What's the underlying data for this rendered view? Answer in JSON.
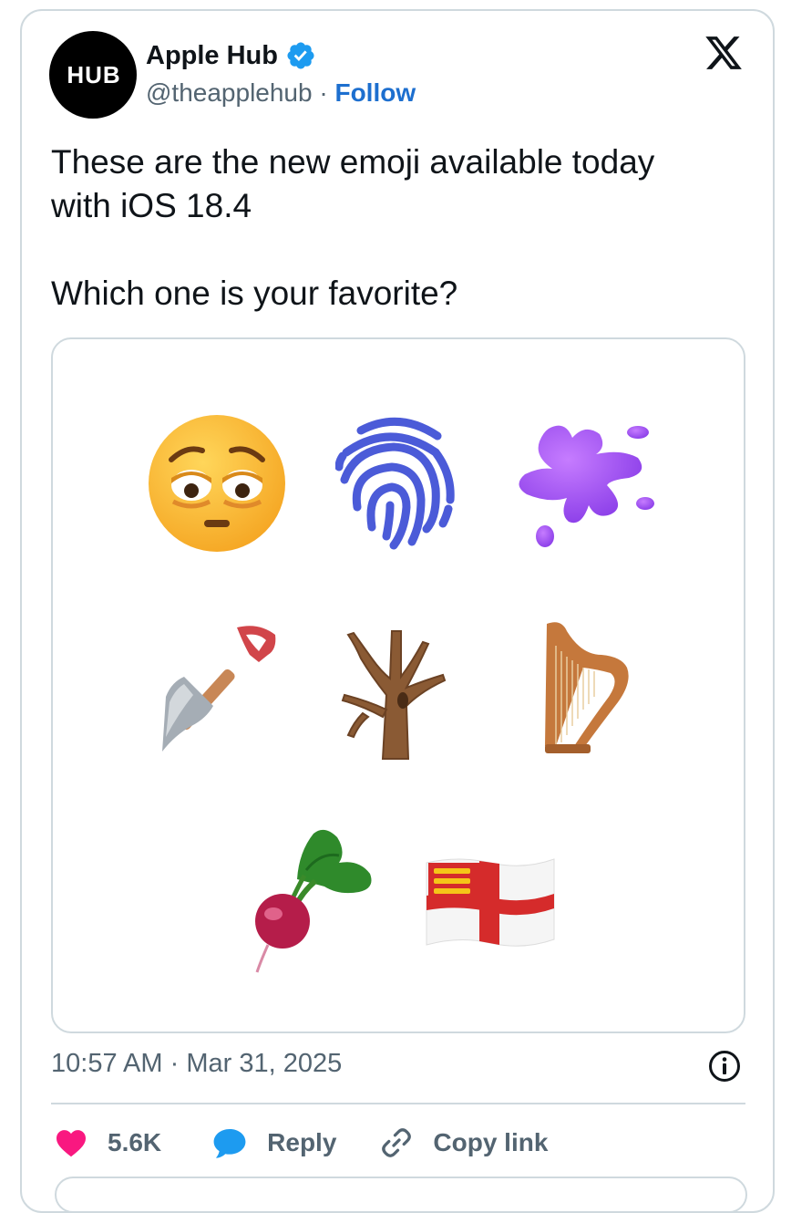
{
  "author": {
    "avatar_text": "HUB",
    "name": "Apple Hub",
    "handle": "@theapplehub",
    "separator": "·",
    "follow_label": "Follow"
  },
  "tweet": {
    "line1": "These are the new emoji available today",
    "line2": "with iOS 18.4",
    "line3": "Which one is your favorite?"
  },
  "emoji": [
    "face-with-bags-under-eyes",
    "fingerprint",
    "splatter",
    "shovel",
    "leafless-tree",
    "harp",
    "root-vegetable",
    "flag-sark"
  ],
  "meta": {
    "time": "10:57 AM",
    "date": "Mar 31, 2025"
  },
  "actions": {
    "likes": "5.6K",
    "reply_label": "Reply",
    "copy_label": "Copy link"
  },
  "colors": {
    "like": "#f91880",
    "reply": "#1d9bf0",
    "link": "#1d6fcf",
    "muted": "#536471",
    "border": "#cfd9de"
  }
}
